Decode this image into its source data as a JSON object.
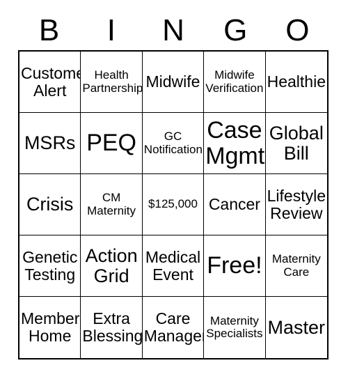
{
  "card": {
    "header_letters": [
      "B",
      "I",
      "N",
      "G",
      "O"
    ],
    "rows": [
      [
        {
          "text": "Customer\nAlert",
          "size": "fs-md"
        },
        {
          "text": "Health\nPartnership",
          "size": "fs-sm"
        },
        {
          "text": "Midwife",
          "size": "fs-md"
        },
        {
          "text": "Midwife\nVerification",
          "size": "fs-sm"
        },
        {
          "text": "Healthie",
          "size": "fs-md"
        }
      ],
      [
        {
          "text": "MSRs",
          "size": "fs-lg"
        },
        {
          "text": "PEQ",
          "size": "fs-xl"
        },
        {
          "text": "GC\nNotification",
          "size": "fs-sm"
        },
        {
          "text": "Case\nMgmt",
          "size": "fs-xl"
        },
        {
          "text": "Global\nBill",
          "size": "fs-lg"
        }
      ],
      [
        {
          "text": "Crisis",
          "size": "fs-lg"
        },
        {
          "text": "CM\nMaternity",
          "size": "fs-sm"
        },
        {
          "text": "$125,000",
          "size": "fs-sm"
        },
        {
          "text": "Cancer",
          "size": "fs-md"
        },
        {
          "text": "Lifestyle\nReview",
          "size": "fs-md"
        }
      ],
      [
        {
          "text": "Genetic\nTesting",
          "size": "fs-md"
        },
        {
          "text": "Action\nGrid",
          "size": "fs-lg"
        },
        {
          "text": "Medical\nEvent",
          "size": "fs-md"
        },
        {
          "text": "Free!",
          "size": "fs-xl"
        },
        {
          "text": "Maternity\nCare",
          "size": "fs-sm"
        }
      ],
      [
        {
          "text": "Member\nHome",
          "size": "fs-md"
        },
        {
          "text": "Extra\nBlessings",
          "size": "fs-md"
        },
        {
          "text": "Care\nManager",
          "size": "fs-md"
        },
        {
          "text": "Maternity\nSpecialists",
          "size": "fs-sm"
        },
        {
          "text": "Master",
          "size": "fs-lg"
        }
      ]
    ]
  },
  "colors": {
    "background": "#ffffff",
    "text": "#000000",
    "grid_line": "#000000"
  }
}
